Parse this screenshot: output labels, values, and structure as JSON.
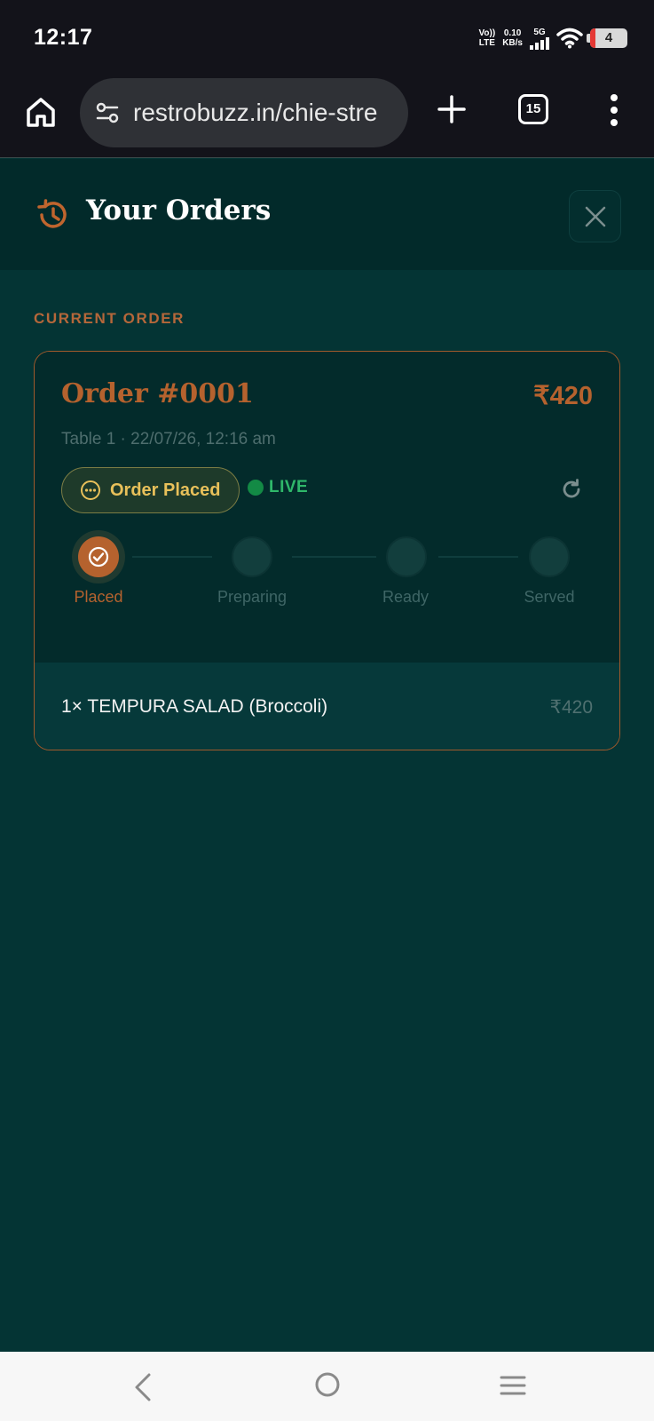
{
  "status_bar": {
    "time": "12:17",
    "volte_line1": "Vo))",
    "volte_line2": "LTE",
    "speed_value": "0.10",
    "speed_unit": "KB/s",
    "network": "5G",
    "battery": "4",
    "battery_level_pct": 15
  },
  "browser": {
    "url": "restrobuzz.in/chie-stre",
    "tab_count": "15"
  },
  "header": {
    "title": "Your Orders"
  },
  "section_label": "CURRENT ORDER",
  "order": {
    "number": "Order #0001",
    "total": "₹420",
    "meta": "Table 1 · 22/07/26, 12:16 am",
    "status": "Order Placed",
    "live_label": "LIVE",
    "steps": [
      {
        "label": "Placed",
        "done": true
      },
      {
        "label": "Preparing",
        "done": false
      },
      {
        "label": "Ready",
        "done": false
      },
      {
        "label": "Served",
        "done": false
      }
    ],
    "items": [
      {
        "name": "1× TEMPURA SALAD (Broccoli)",
        "price": "₹420"
      }
    ]
  },
  "colors": {
    "background": "#043434",
    "accent": "#b5622e",
    "status_yellow": "#e8c05a",
    "live_green": "#2fb86a"
  },
  "icons": {
    "history": "history-icon",
    "close": "close-icon",
    "refresh": "refresh-icon",
    "status": "more-horizontal-circle-icon",
    "check": "check-circle-icon"
  }
}
